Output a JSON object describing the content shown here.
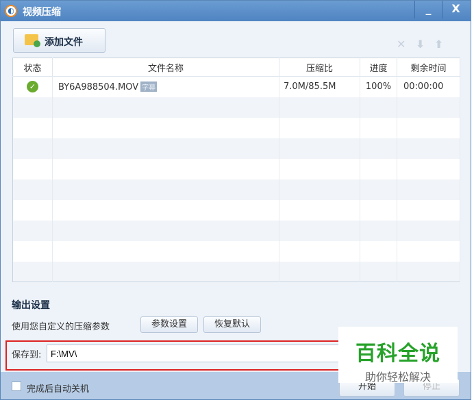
{
  "window": {
    "title": "视频压缩",
    "minimize": "_",
    "close": "X"
  },
  "toolbar": {
    "add_file": "添加文件",
    "delete": "✕",
    "move_down": "⬇",
    "move_up": "⬆"
  },
  "table": {
    "headers": [
      "状态",
      "文件名称",
      "压缩比",
      "进度",
      "剩余时间"
    ],
    "rows": [
      {
        "status": "done",
        "filename": "BY6A988504.MOV",
        "tag": "字幕",
        "ratio": "7.0M/85.5M",
        "progress": "100%",
        "remaining": "00:00:00"
      }
    ]
  },
  "output": {
    "title": "输出设置",
    "description": "使用您自定义的压缩参数",
    "params_button": "参数设置",
    "restore_button": "恢复默认",
    "save_label": "保存到:",
    "save_path": "F:\\MV\\"
  },
  "footer": {
    "shutdown_label": "完成后自动关机",
    "start": "开始",
    "stop": "停止"
  },
  "watermark": {
    "title": "百科全说",
    "subtitle": "助你轻松解决"
  }
}
